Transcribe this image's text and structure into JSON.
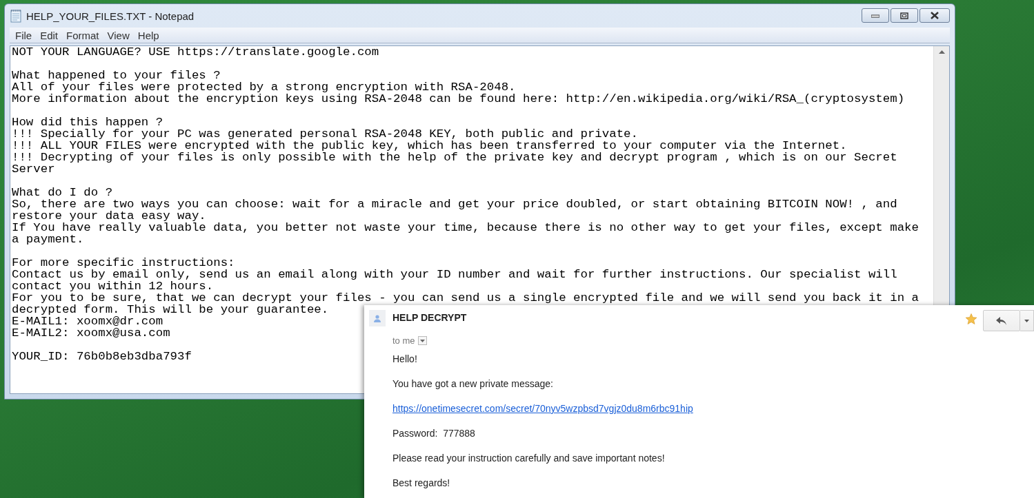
{
  "notepad": {
    "title": "HELP_YOUR_FILES.TXT - Notepad",
    "menu": [
      "File",
      "Edit",
      "Format",
      "View",
      "Help"
    ],
    "paragraphs": [
      [
        "NOT YOUR LANGUAGE? USE https://translate.google.com"
      ],
      [
        "What happened to your files ?",
        "All of your files were protected by a strong encryption with RSA-2048.",
        "More information about the encryption keys using RSA-2048 can be found here: http://en.wikipedia.org/wiki/RSA_(cryptosystem)"
      ],
      [
        "How did this happen ?",
        "!!! Specially for your PC was generated personal RSA-2048 KEY, both public and private.",
        "!!! ALL YOUR FILES were encrypted with the public key, which has been transferred to your computer via the Internet.",
        "!!! Decrypting of your files is only possible with the help of the private key and decrypt program , which is on our Secret",
        "Server"
      ],
      [
        "What do I do ?",
        "So, there are two ways you can choose: wait for a miracle and get your price doubled, or start obtaining BITCOIN NOW! , and",
        "restore your data easy way.",
        "If You have really valuable data, you better not waste your time, because there is no other way to get your files, except make",
        "a payment."
      ],
      [
        "For more specific instructions:",
        "Contact us by email only, send us an email along with your ID number and wait for further instructions. Our specialist will",
        "contact you within 12 hours.",
        "For you to be sure, that we can decrypt your files - you can send us a single encrypted file and we will send you back it in a",
        "decrypted form. This will be your guarantee.",
        "E-MAIL1: xoomx@dr.com",
        "E-MAIL2: xoomx@usa.com"
      ],
      [
        "YOUR_ID: 76b0b8eb3dba793f"
      ]
    ]
  },
  "email": {
    "sender": "HELP DECRYPT",
    "recipient": "to me",
    "starred": true,
    "body": [
      {
        "kind": "text",
        "text": "Hello!"
      },
      {
        "kind": "text",
        "text": "You have got a new private message:"
      },
      {
        "kind": "link",
        "text": "https://onetimesecret.com/secret/70nyv5wzpbsd7vgjz0du8m6rbc91hip"
      },
      {
        "kind": "text",
        "text": "Password:  777888"
      },
      {
        "kind": "text",
        "text": "Please read your instruction carefully and save important notes!"
      },
      {
        "kind": "text",
        "text": "Best regards!"
      }
    ]
  }
}
